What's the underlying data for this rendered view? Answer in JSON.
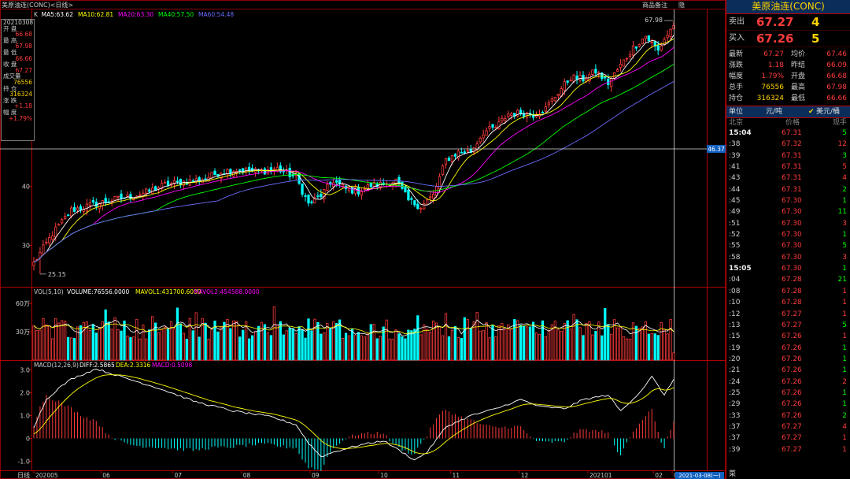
{
  "header": {
    "left_title": "美原油连(CONC)<日线>",
    "btn_remark": "商品备注",
    "btn_hide": "隐",
    "ma_label": "K",
    "ma5": "MA5:63.62",
    "ma10": "MA10:62.81",
    "ma20": "MA20:63.30",
    "ma40": "MA40:57.50",
    "ma60": "MA60:54.48"
  },
  "colors": {
    "up": "#ff3b3b",
    "down": "#00ffff",
    "ma5": "#ffffff",
    "ma10": "#ffff00",
    "ma20": "#ff00ff",
    "ma40": "#00ff00",
    "ma60": "#6c6cff",
    "grid": "#8b0000",
    "text": "#cccccc",
    "yellow": "#ffd200"
  },
  "infobox": {
    "date": "20210308",
    "open_label": "开 盘",
    "open": "66.68",
    "high_label": "最 高",
    "high": "67.98",
    "low_label": "最 低",
    "low": "66.66",
    "close_label": "收 盘",
    "close": "67.27",
    "vol_label": "成交量",
    "vol": "76556",
    "oi_label": "持 仓",
    "oi": "316324",
    "chg_label": "涨 跌",
    "chg": "+1.18",
    "pct_label": "幅 度",
    "pct": "+1.79%"
  },
  "price_axis": {
    "ticks": [
      "40",
      "30"
    ],
    "crosshair_value": "46.37",
    "high_mark": "67.98",
    "low_mark": "25.15"
  },
  "volume": {
    "header_a": "VOL(5,10)",
    "header_b": "VOLUME:76556.0000",
    "header_c": "MAVOL1:431700.6000",
    "header_d": "MAVOL2:454588.0000",
    "ticks": [
      "60万",
      "30万"
    ]
  },
  "macd": {
    "header_a": "MACD(12,26,9)",
    "header_b": "DIFF:2.5865",
    "header_c": "DEA:2.3316",
    "header_d": "MACD:0.5098",
    "ticks": [
      "3.0",
      "2.0",
      "1.0",
      "0",
      "-1.0"
    ]
  },
  "xaxis": {
    "mode_label": "日线",
    "labels": [
      "202005",
      "06",
      "07",
      "08",
      "09",
      "10",
      "11",
      "12",
      "202101",
      "02",
      "03"
    ],
    "cursor_date": "2021-03-08(一)"
  },
  "panel": {
    "title": "美原油连(CONC)",
    "sell_label": "卖出",
    "sell_price": "67.27",
    "sell_vol": "4",
    "buy_label": "买入",
    "buy_price": "67.26",
    "buy_vol": "5",
    "stats": [
      {
        "k1": "最新",
        "v1": "67.27",
        "k2": "均价",
        "v2": "67.46"
      },
      {
        "k1": "涨跌",
        "v1": "1.18",
        "k2": "昨结",
        "v2": "66.09"
      },
      {
        "k1": "幅度",
        "v1": "1.79%",
        "k2": "开盘",
        "v2": "66.68"
      },
      {
        "k1": "总手",
        "v1": "76556",
        "k2": "最高",
        "v2": "67.98"
      },
      {
        "k1": "持仓",
        "v1": "316324",
        "k2": "最低",
        "v2": "66.66"
      }
    ],
    "unit_label": "单位",
    "unit_value": "元/吨",
    "unit_alt": "美元/桶",
    "th_time": "北京",
    "th_price": "价格",
    "th_vol": "现手",
    "ticks": [
      {
        "t": "15:04",
        "p": "67.31",
        "v": "5",
        "pc": "up",
        "vc": "down"
      },
      {
        "t": ":38",
        "p": "67.32",
        "v": "12",
        "pc": "up",
        "vc": "up"
      },
      {
        "t": ":39",
        "p": "67.31",
        "v": "3",
        "pc": "up",
        "vc": "down"
      },
      {
        "t": ":41",
        "p": "67.31",
        "v": "5",
        "pc": "up",
        "vc": "up"
      },
      {
        "t": ":43",
        "p": "67.31",
        "v": "4",
        "pc": "up",
        "vc": "up"
      },
      {
        "t": ":44",
        "p": "67.31",
        "v": "2",
        "pc": "up",
        "vc": "down"
      },
      {
        "t": ":45",
        "p": "67.30",
        "v": "1",
        "pc": "up",
        "vc": "down"
      },
      {
        "t": ":49",
        "p": "67.30",
        "v": "11",
        "pc": "up",
        "vc": "down"
      },
      {
        "t": ":51",
        "p": "67.30",
        "v": "3",
        "pc": "up",
        "vc": "up"
      },
      {
        "t": ":52",
        "p": "67.30",
        "v": "1",
        "pc": "up",
        "vc": "down"
      },
      {
        "t": ":55",
        "p": "67.30",
        "v": "5",
        "pc": "up",
        "vc": "down"
      },
      {
        "t": ":58",
        "p": "67.30",
        "v": "3",
        "pc": "up",
        "vc": "up"
      },
      {
        "t": "15:05",
        "p": "67.30",
        "v": "1",
        "pc": "up",
        "vc": "down"
      },
      {
        "t": ":04",
        "p": "67.28",
        "v": "21",
        "pc": "up",
        "vc": "down"
      },
      {
        "t": ":08",
        "p": "67.28",
        "v": "1",
        "pc": "up",
        "vc": "up"
      },
      {
        "t": ":10",
        "p": "67.28",
        "v": "1",
        "pc": "up",
        "vc": "up"
      },
      {
        "t": ":12",
        "p": "67.27",
        "v": "1",
        "pc": "up",
        "vc": "up"
      },
      {
        "t": ":13",
        "p": "67.27",
        "v": "5",
        "pc": "up",
        "vc": "down"
      },
      {
        "t": ":15",
        "p": "67.26",
        "v": "1",
        "pc": "up",
        "vc": "up"
      },
      {
        "t": ":19",
        "p": "67.26",
        "v": "1",
        "pc": "up",
        "vc": "down"
      },
      {
        "t": ":20",
        "p": "67.26",
        "v": "1",
        "pc": "up",
        "vc": "down"
      },
      {
        "t": ":21",
        "p": "67.26",
        "v": "1",
        "pc": "up",
        "vc": "down"
      },
      {
        "t": ":24",
        "p": "67.26",
        "v": "2",
        "pc": "up",
        "vc": "up"
      },
      {
        "t": ":25",
        "p": "67.26",
        "v": "1",
        "pc": "up",
        "vc": "down"
      },
      {
        "t": ":29",
        "p": "67.26",
        "v": "1",
        "pc": "up",
        "vc": "down"
      },
      {
        "t": ":33",
        "p": "67.26",
        "v": "2",
        "pc": "up",
        "vc": "down"
      },
      {
        "t": ":37",
        "p": "67.27",
        "v": "4",
        "pc": "up",
        "vc": "up"
      },
      {
        "t": ":37",
        "p": "67.27",
        "v": "1",
        "pc": "up",
        "vc": "up"
      },
      {
        "t": ":39",
        "p": "67.27",
        "v": "1",
        "pc": "up",
        "vc": "up"
      }
    ],
    "footer": "菜"
  },
  "chart_data": {
    "type": "candlestick",
    "period": "daily",
    "date_range": [
      "2020-05",
      "2021-03-08"
    ],
    "ylim_price": [
      23,
      70
    ],
    "ylim_volume": [
      0,
      700000
    ],
    "ylim_macd": [
      -1.4,
      3.4
    ],
    "last_bar": {
      "date": "2021-03-08",
      "open": 66.68,
      "high": 67.98,
      "low": 66.66,
      "close": 67.27,
      "volume": 76556,
      "open_interest": 316324
    },
    "close_keypoints": [
      [
        0,
        27.0
      ],
      [
        6,
        32.0
      ],
      [
        12,
        36.0
      ],
      [
        18,
        36.8
      ],
      [
        24,
        37.6
      ],
      [
        30,
        38.2
      ],
      [
        36,
        39.0
      ],
      [
        42,
        40.3
      ],
      [
        48,
        40.8
      ],
      [
        54,
        41.2
      ],
      [
        60,
        42.5
      ],
      [
        66,
        42.9
      ],
      [
        72,
        42.5
      ],
      [
        78,
        43.0
      ],
      [
        84,
        41.5
      ],
      [
        88,
        37.0
      ],
      [
        92,
        38.5
      ],
      [
        96,
        41.0
      ],
      [
        100,
        39.5
      ],
      [
        104,
        39.2
      ],
      [
        108,
        40.2
      ],
      [
        112,
        40.4
      ],
      [
        116,
        41.0
      ],
      [
        120,
        37.6
      ],
      [
        124,
        36.6
      ],
      [
        128,
        38.5
      ],
      [
        132,
        44.5
      ],
      [
        136,
        45.8
      ],
      [
        140,
        45.9
      ],
      [
        144,
        49.2
      ],
      [
        148,
        50.0
      ],
      [
        152,
        52.3
      ],
      [
        156,
        52.5
      ],
      [
        160,
        52.2
      ],
      [
        164,
        53.2
      ],
      [
        168,
        56.0
      ],
      [
        172,
        58.5
      ],
      [
        176,
        58.2
      ],
      [
        180,
        59.5
      ],
      [
        184,
        57.5
      ],
      [
        188,
        60.5
      ],
      [
        192,
        63.5
      ],
      [
        196,
        65.5
      ],
      [
        200,
        63.0
      ],
      [
        202,
        65.0
      ],
      [
        205,
        67.27
      ]
    ],
    "macd_diff_keypoints": [
      [
        0,
        0.5
      ],
      [
        4,
        1.7
      ],
      [
        8,
        2.2
      ],
      [
        12,
        2.6
      ],
      [
        20,
        3.05
      ],
      [
        28,
        2.7
      ],
      [
        40,
        2.2
      ],
      [
        52,
        1.6
      ],
      [
        64,
        1.2
      ],
      [
        76,
        0.95
      ],
      [
        84,
        0.6
      ],
      [
        88,
        -0.2
      ],
      [
        92,
        -0.8
      ],
      [
        96,
        -0.6
      ],
      [
        104,
        -0.3
      ],
      [
        112,
        -0.1
      ],
      [
        118,
        -0.6
      ],
      [
        122,
        -0.95
      ],
      [
        126,
        -0.6
      ],
      [
        132,
        0.5
      ],
      [
        140,
        1.0
      ],
      [
        148,
        1.3
      ],
      [
        156,
        1.7
      ],
      [
        162,
        1.4
      ],
      [
        170,
        1.3
      ],
      [
        176,
        1.7
      ],
      [
        184,
        1.9
      ],
      [
        188,
        1.2
      ],
      [
        194,
        2.0
      ],
      [
        198,
        2.7
      ],
      [
        202,
        1.9
      ],
      [
        205,
        2.59
      ]
    ]
  }
}
